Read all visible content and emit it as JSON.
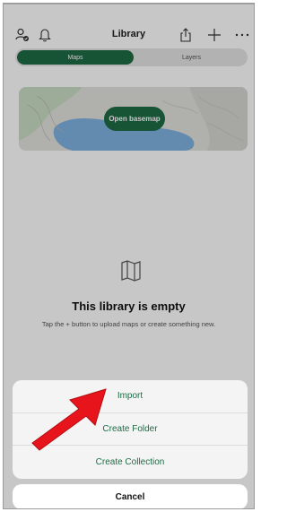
{
  "header": {
    "title": "Library",
    "left_icons": [
      "account-check-icon",
      "bell-icon"
    ],
    "right_icons": [
      "share-icon",
      "plus-icon",
      "more-icon"
    ]
  },
  "segments": {
    "maps": "Maps",
    "layers": "Layers"
  },
  "basemap": {
    "button_label": "Open basemap"
  },
  "empty_state": {
    "title": "This library is empty",
    "subtitle": "Tap the + button to upload maps or create something new.",
    "icon": "map-icon"
  },
  "action_sheet": {
    "items": [
      "Import",
      "Create Folder",
      "Create Collection"
    ],
    "cancel": "Cancel"
  },
  "colors": {
    "accent": "#1e6b45",
    "annotation_arrow": "#e8141c"
  }
}
